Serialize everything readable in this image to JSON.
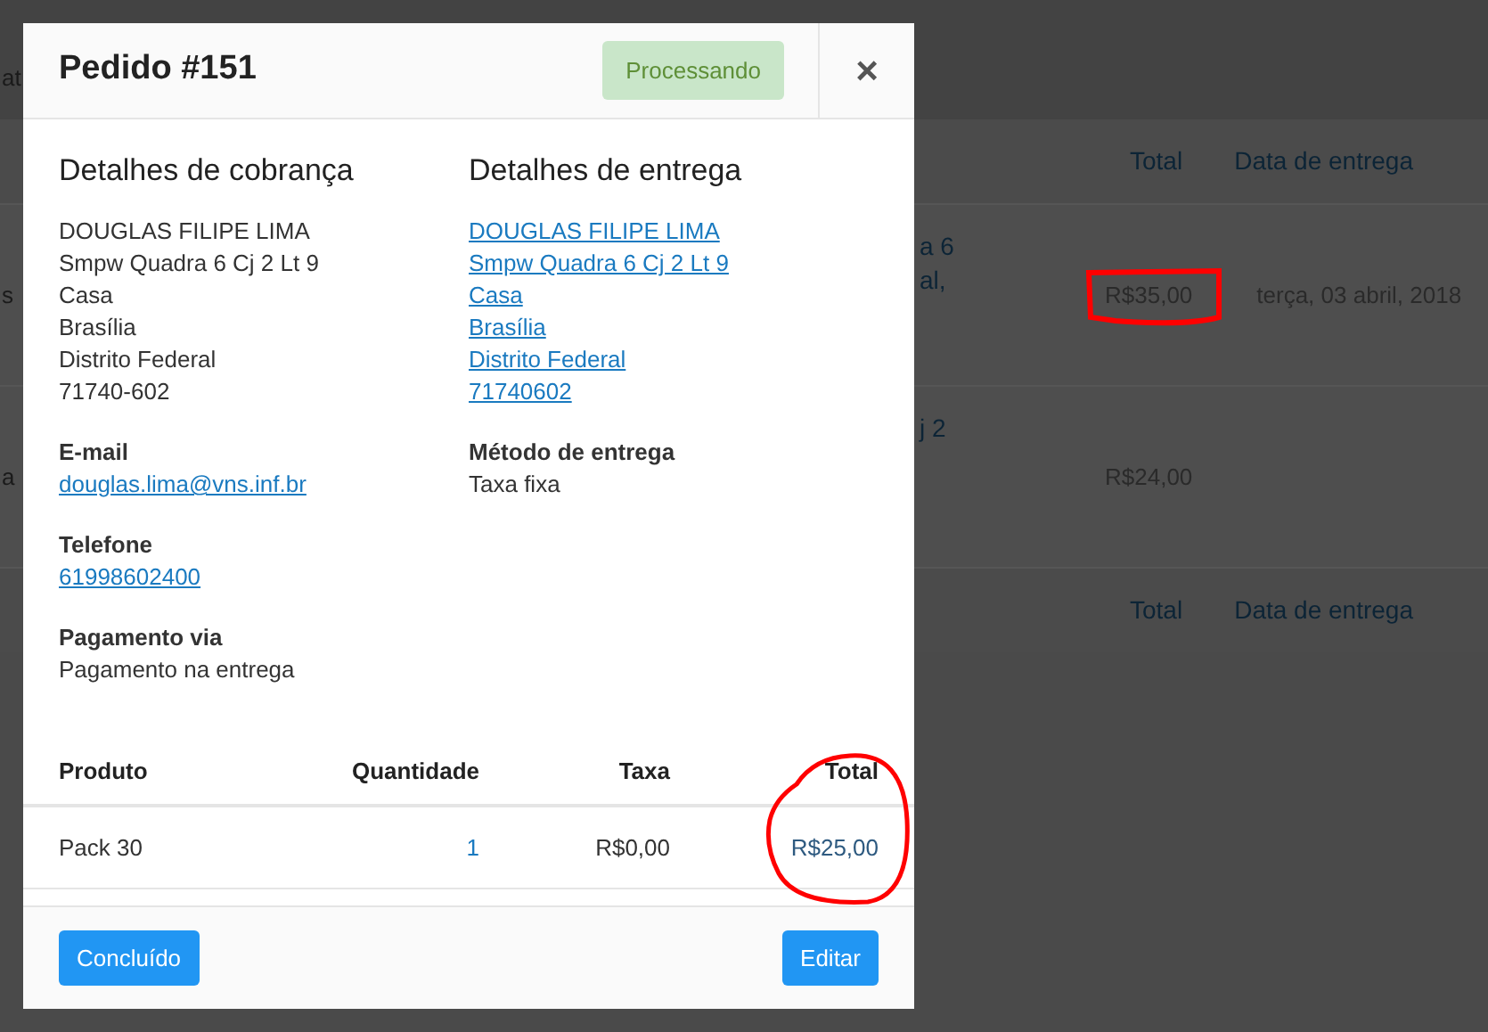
{
  "background": {
    "top_fragment": "at",
    "columns": [
      "Total",
      "Data de entrega"
    ],
    "rows": [
      {
        "left_fragment": "s",
        "address_fragments": [
          "a 6",
          "al,"
        ],
        "total": "R$35,00",
        "date": "terça, 03 abril, 2018"
      },
      {
        "left_fragment": "a",
        "address_fragments": [
          "j 2"
        ],
        "total": "R$24,00"
      }
    ],
    "footer_columns": [
      "Total",
      "Data de entrega"
    ]
  },
  "modal": {
    "title": "Pedido #151",
    "status": "Processando",
    "close": "×",
    "billing": {
      "heading": "Detalhes de cobrança",
      "lines": [
        "DOUGLAS FILIPE LIMA",
        "Smpw Quadra 6 Cj 2 Lt 9",
        "Casa",
        "Brasília",
        "Distrito Federal",
        "71740-602"
      ],
      "fields": [
        {
          "label": "E-mail",
          "value": "douglas.lima@vns.inf.br",
          "kind": "link"
        },
        {
          "label": "Telefone",
          "value": "61998602400",
          "kind": "link"
        },
        {
          "label": "Pagamento via",
          "value": "Pagamento na entrega",
          "kind": "text"
        }
      ]
    },
    "shipping": {
      "heading": "Detalhes de entrega",
      "lines": [
        "DOUGLAS FILIPE LIMA",
        "Smpw Quadra 6 Cj 2 Lt 9",
        "Casa",
        "Brasília",
        "Distrito Federal",
        "71740602"
      ],
      "fields": [
        {
          "label": "Método de entrega",
          "value": "Taxa fixa",
          "kind": "text"
        }
      ]
    },
    "products": {
      "columns": [
        "Produto",
        "Quantidade",
        "Taxa",
        "Total"
      ],
      "rows": [
        {
          "product": "Pack 30",
          "quantity": "1",
          "tax": "R$0,00",
          "total": "R$25,00"
        }
      ]
    },
    "buttons": [
      "Concluído",
      "Editar"
    ]
  }
}
